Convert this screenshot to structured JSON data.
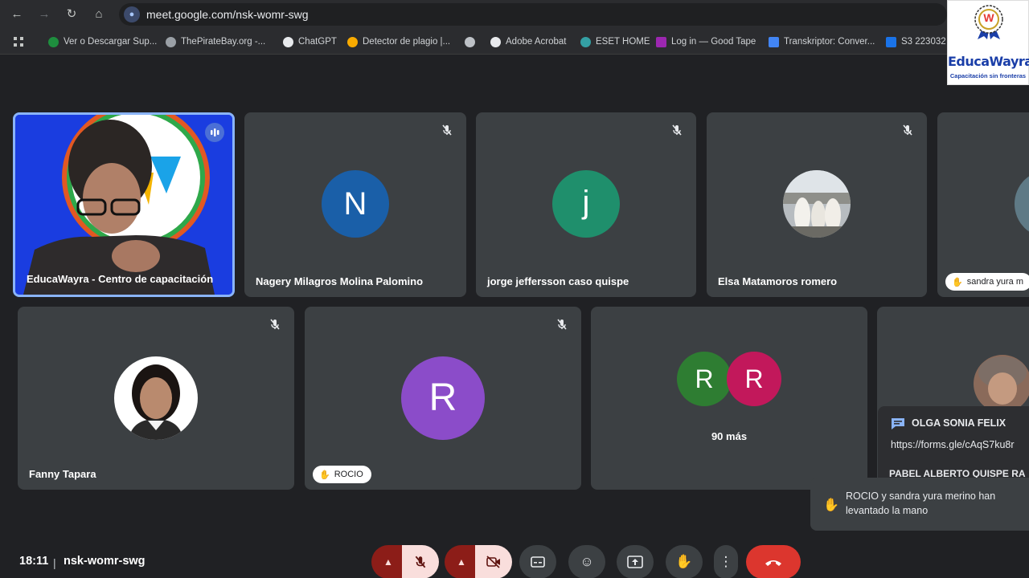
{
  "browser": {
    "url": "meet.google.com/nsk-womr-swg",
    "bookmarks": [
      "Ver o Descargar Sup...",
      "ThePirateBay.org -...",
      "ChatGPT",
      "Detector de plagio |...",
      "",
      "Adobe Acrobat",
      "ESET HOME",
      "Log in — Good Tape",
      "Transkriptor: Conver...",
      "S3 223032 -"
    ]
  },
  "logo": {
    "brand": "EducaWayra",
    "tagline": "Capacitación sin fronteras",
    "mark": "W"
  },
  "tiles_row1": [
    {
      "name": "EducaWayra - Centro de capacitación"
    },
    {
      "name": "Nagery Milagros Molina Palomino",
      "initial": "N",
      "color": "#1a5fa8"
    },
    {
      "name": "jorge jeffersson caso quispe",
      "initial": "j",
      "color": "#1f8f6c"
    },
    {
      "name": "Elsa Matamoros romero"
    },
    {
      "chip": "sandra yura m"
    }
  ],
  "tiles_row2": [
    {
      "name": "Fanny Tapara"
    },
    {
      "chip": "ROCIO",
      "initial": "R",
      "color": "#8b4cc9"
    },
    {
      "initial_a": "R",
      "color_a": "#2e7d32",
      "initial_b": "R",
      "color_b": "#c2185b",
      "more": "90 más"
    }
  ],
  "chat": {
    "sender": "OLGA SONIA FELIX",
    "message": "https://forms.gle/cAqS7ku8r",
    "next_sender": "PABEL ALBERTO QUISPE RA"
  },
  "toast": {
    "text": "ROCIO y sandra yura merino han levantado la mano"
  },
  "bottom": {
    "time": "18:11",
    "separator": "|",
    "meeting_code": "nsk-womr-swg"
  },
  "colors": {
    "background": "#202124",
    "tile": "#3c4043",
    "active_speaker": "#8ab4f8",
    "end_call": "#dc362e"
  }
}
